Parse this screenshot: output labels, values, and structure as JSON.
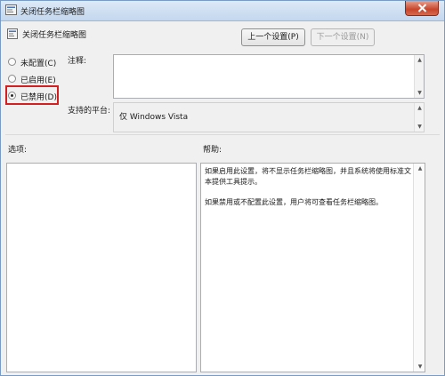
{
  "window": {
    "title": "关闭任务栏缩略图"
  },
  "header": {
    "policy_title": "关闭任务栏缩略图",
    "prev_button": "上一个设置(P)",
    "next_button": "下一个设置(N)"
  },
  "options": {
    "items": [
      {
        "label": "未配置(C)",
        "checked": false
      },
      {
        "label": "已启用(E)",
        "checked": false
      },
      {
        "label": "已禁用(D)",
        "checked": true
      }
    ]
  },
  "comment": {
    "label": "注释:",
    "value": ""
  },
  "supported": {
    "label": "支持的平台:",
    "value": "仅 Windows Vista"
  },
  "panels": {
    "options_label": "选项:",
    "help_label": "帮助:",
    "help_paragraphs": [
      "如果启用此设置，将不显示任务栏缩略图，并且系统将使用标准文本提供工具提示。",
      "如果禁用或不配置此设置，用户将可查看任务栏缩略图。"
    ]
  },
  "colors": {
    "highlight": "#d21f1f",
    "titlebar": "#c3d7ee",
    "close_button": "#c8452b"
  },
  "icons": {
    "title": "policy-icon",
    "header": "policy-icon",
    "close": "close-icon"
  }
}
